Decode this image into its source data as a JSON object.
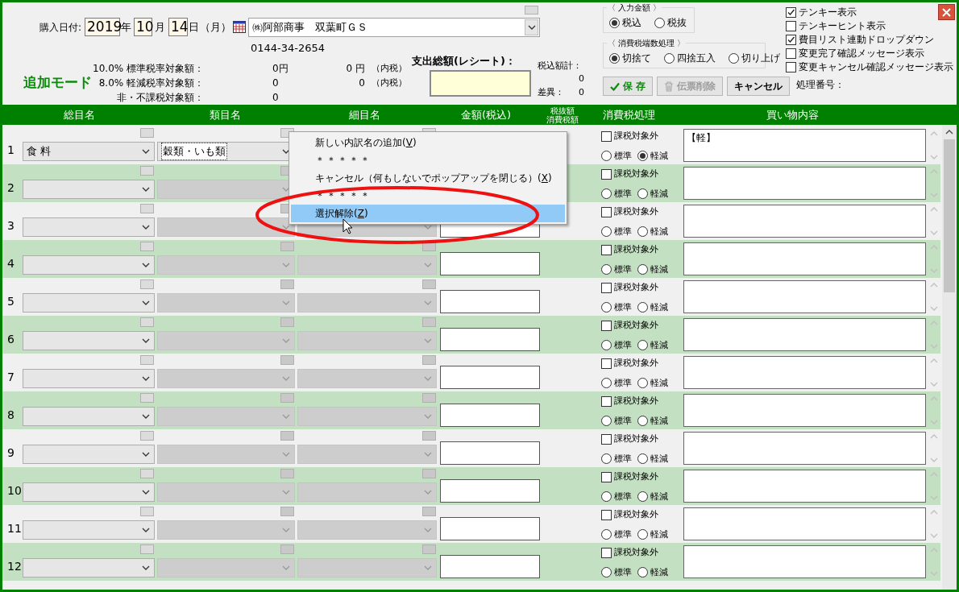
{
  "header": {
    "date_label": "購入日付:",
    "year": "2019",
    "year_unit": "年",
    "month": "10",
    "month_unit": "月",
    "day": "14",
    "day_unit": "日",
    "weekday": "（月）",
    "store": "㈱阿部商事　双葉町ＧＳ",
    "phone": "0144-34-2654",
    "mode": "追加モード",
    "tax_rows": [
      {
        "label": "10.0% 標準税率対象額：",
        "amount": "0",
        "amount_unit": "円",
        "tax": "0",
        "tax_unit": "円",
        "tax_note": "（内税）"
      },
      {
        "label": "8.0% 軽減税率対象額：",
        "amount": "0",
        "tax": "0",
        "tax_note": "（内税）"
      },
      {
        "label": "非・不課税対象額：",
        "amount": "0"
      }
    ],
    "receipt_total_label": "支出総額(レシート)：",
    "sum_label": "税込額計：",
    "sum_value": "0",
    "diff_label": "差異：",
    "diff_value": "0"
  },
  "input_amount": {
    "title": "〈 入力金額 〉",
    "options": [
      {
        "label": "税込",
        "selected": true
      },
      {
        "label": "税抜",
        "selected": false
      }
    ]
  },
  "rounding": {
    "title": "〈 消費税端数処理 〉",
    "options": [
      {
        "label": "切捨て",
        "selected": true
      },
      {
        "label": "四捨五入",
        "selected": false
      },
      {
        "label": "切り上げ",
        "selected": false
      }
    ]
  },
  "buttons": [
    {
      "label": "保 存",
      "kind": "save",
      "disabled": false
    },
    {
      "label": "伝票削除",
      "kind": "delete",
      "disabled": true
    },
    {
      "label": "キャンセル",
      "kind": "plain",
      "disabled": false
    }
  ],
  "settings": [
    {
      "label": "テンキー表示",
      "checked": true
    },
    {
      "label": "テンキーヒント表示",
      "checked": false
    },
    {
      "label": "費目リスト連動ドロップダウン",
      "checked": true
    },
    {
      "label": "変更完了確認メッセージ表示",
      "checked": false
    },
    {
      "label": "変更キャンセル確認メッセージ表示",
      "checked": false
    }
  ],
  "process_no_label": "処理番号：",
  "columns": [
    {
      "lines": [
        "総目名"
      ]
    },
    {
      "lines": [
        "類目名"
      ]
    },
    {
      "lines": [
        "細目名"
      ]
    },
    {
      "lines": [
        "金額(税込)"
      ]
    },
    {
      "lines": [
        "税抜額",
        "消費税額"
      ]
    },
    {
      "lines": [
        "消費税処理"
      ]
    },
    {
      "lines": [
        "買い物内容"
      ]
    }
  ],
  "rows": [
    {
      "no": "1",
      "major": {
        "value": "食 料",
        "disabled": false
      },
      "minor": {
        "value": "穀類・いも類",
        "disabled": false
      },
      "exempt": {
        "label": "課税対象外",
        "checked": false
      },
      "rates": [
        {
          "label": "標準",
          "selected": false
        },
        {
          "label": "軽減",
          "selected": true
        }
      ],
      "content": "【軽】"
    },
    {
      "no": "2",
      "major": {
        "disabled": false
      },
      "minor": {
        "disabled": true
      },
      "exempt": {
        "label": "課税対象外",
        "checked": false
      },
      "rates": [
        {
          "label": "標準",
          "selected": false
        },
        {
          "label": "軽減",
          "selected": false
        }
      ]
    },
    {
      "no": "3",
      "major": {
        "disabled": false
      },
      "minor": {
        "disabled": true
      },
      "detail": {
        "disabled": true
      },
      "exempt": {
        "label": "課税対象外",
        "checked": false
      },
      "rates": [
        {
          "label": "標準",
          "selected": false
        },
        {
          "label": "軽減",
          "selected": false
        }
      ]
    },
    {
      "no": "4",
      "major": {
        "disabled": false
      },
      "minor": {
        "disabled": true
      },
      "detail": {
        "disabled": true
      },
      "exempt": {
        "label": "課税対象外",
        "checked": false
      },
      "rates": [
        {
          "label": "標準",
          "selected": false
        },
        {
          "label": "軽減",
          "selected": false
        }
      ]
    },
    {
      "no": "5",
      "major": {
        "disabled": false
      },
      "minor": {
        "disabled": true
      },
      "detail": {
        "disabled": true
      },
      "exempt": {
        "label": "課税対象外",
        "checked": false
      },
      "rates": [
        {
          "label": "標準",
          "selected": false
        },
        {
          "label": "軽減",
          "selected": false
        }
      ]
    },
    {
      "no": "6",
      "major": {
        "disabled": false
      },
      "minor": {
        "disabled": true
      },
      "detail": {
        "disabled": true
      },
      "exempt": {
        "label": "課税対象外",
        "checked": false
      },
      "rates": [
        {
          "label": "標準",
          "selected": false
        },
        {
          "label": "軽減",
          "selected": false
        }
      ]
    },
    {
      "no": "7",
      "major": {
        "disabled": false
      },
      "minor": {
        "disabled": true
      },
      "detail": {
        "disabled": true
      },
      "exempt": {
        "label": "課税対象外",
        "checked": false
      },
      "rates": [
        {
          "label": "標準",
          "selected": false
        },
        {
          "label": "軽減",
          "selected": false
        }
      ]
    },
    {
      "no": "8",
      "major": {
        "disabled": false
      },
      "minor": {
        "disabled": true
      },
      "detail": {
        "disabled": true
      },
      "exempt": {
        "label": "課税対象外",
        "checked": false
      },
      "rates": [
        {
          "label": "標準",
          "selected": false
        },
        {
          "label": "軽減",
          "selected": false
        }
      ]
    },
    {
      "no": "9",
      "major": {
        "disabled": false
      },
      "minor": {
        "disabled": true
      },
      "detail": {
        "disabled": true
      },
      "exempt": {
        "label": "課税対象外",
        "checked": false
      },
      "rates": [
        {
          "label": "標準",
          "selected": false
        },
        {
          "label": "軽減",
          "selected": false
        }
      ]
    },
    {
      "no": "10",
      "major": {
        "disabled": false
      },
      "minor": {
        "disabled": true
      },
      "detail": {
        "disabled": true
      },
      "exempt": {
        "label": "課税対象外",
        "checked": false
      },
      "rates": [
        {
          "label": "標準",
          "selected": false
        },
        {
          "label": "軽減",
          "selected": false
        }
      ]
    },
    {
      "no": "11",
      "major": {
        "disabled": false
      },
      "minor": {
        "disabled": true
      },
      "detail": {
        "disabled": true
      },
      "exempt": {
        "label": "課税対象外",
        "checked": false
      },
      "rates": [
        {
          "label": "標準",
          "selected": false
        },
        {
          "label": "軽減",
          "selected": false
        }
      ]
    },
    {
      "no": "12",
      "major": {
        "disabled": false
      },
      "minor": {
        "disabled": true
      },
      "detail": {
        "disabled": true
      },
      "exempt": {
        "label": "課税対象外",
        "checked": false
      },
      "rates": [
        {
          "label": "標準",
          "selected": false
        },
        {
          "label": "軽減",
          "selected": false
        }
      ]
    }
  ],
  "context_menu": {
    "items": [
      {
        "kind": "item",
        "label": "新しい内訳名の追加",
        "accel": "(V)",
        "selected": false
      },
      {
        "kind": "separator",
        "label": "＊＊＊＊＊",
        "selected": false
      },
      {
        "kind": "item",
        "label": "キャンセル（何もしないでポップアップを閉じる）",
        "accel": "(X)",
        "selected": false
      },
      {
        "kind": "separator",
        "label": "＊＊＊＊＊",
        "selected": false
      },
      {
        "kind": "item",
        "label": "選択解除",
        "accel": "(Z)",
        "selected": true
      }
    ]
  }
}
